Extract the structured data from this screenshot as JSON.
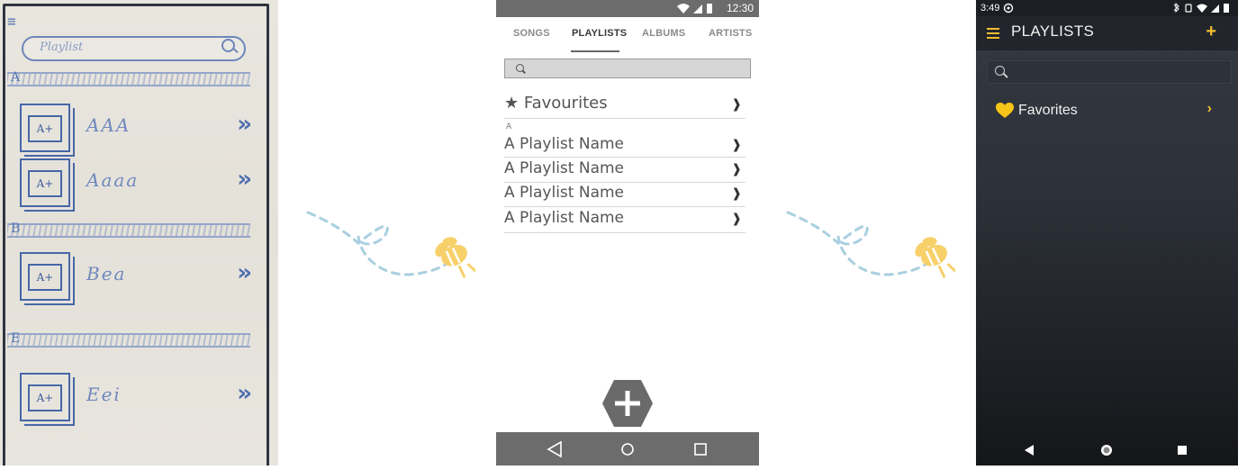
{
  "sketch": {
    "hamburger": "≡",
    "search_placeholder": "Playlist",
    "sections": [
      "A",
      "B",
      "E"
    ],
    "thumb_label": "A+",
    "items": [
      {
        "name": "AAA",
        "arrow": "»"
      },
      {
        "name": "Aaaa",
        "arrow": "»"
      },
      {
        "name": "Bea",
        "arrow": "»"
      },
      {
        "name": "Eei",
        "arrow": "»"
      }
    ]
  },
  "wireframe": {
    "status_time": "12:30",
    "tabs": [
      "SONGS",
      "PLAYLISTS",
      "ALBUMS",
      "ARTISTS"
    ],
    "active_tab": "PLAYLISTS",
    "favourites": {
      "icon": "★",
      "label": "Favourites",
      "chevron": "❱"
    },
    "section_letter": "A",
    "playlists": [
      {
        "label": "A Playlist Name",
        "chevron": "❱"
      },
      {
        "label": "A Playlist Name",
        "chevron": "❱"
      },
      {
        "label": "A Playlist Name",
        "chevron": "❱"
      },
      {
        "label": "A Playlist Name",
        "chevron": "❱"
      }
    ],
    "fab_icon": "plus-icon",
    "nav_icons": [
      "back-icon",
      "home-icon",
      "recents-icon"
    ]
  },
  "app": {
    "status_time": "3:49",
    "title": "PLAYLISTS",
    "add_label": "+",
    "favorites": {
      "icon": "yellow-heart-icon",
      "label": "Favorites",
      "chevron": "›"
    },
    "accent_color": "#f3bd2c",
    "nav_icons": [
      "back-icon",
      "home-icon",
      "recents-icon"
    ]
  }
}
